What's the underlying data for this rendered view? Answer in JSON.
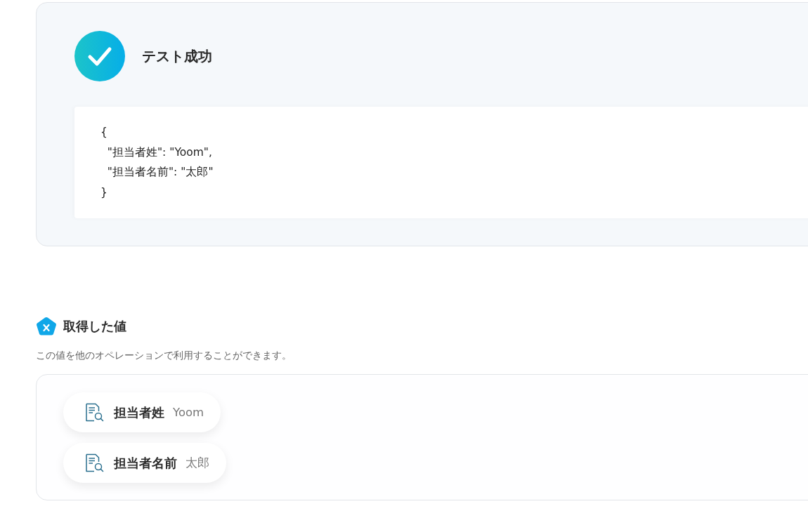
{
  "test_result": {
    "passed": true,
    "title": "テスト成功",
    "output": "{\n  \"担当者姓\": \"Yoom\",\n  \"担当者名前\": \"太郎\"\n}"
  },
  "retrieved_values": {
    "title": "取得した値",
    "description": "この値を他のオペレーションで利用することができます。",
    "items": [
      {
        "label": "担当者姓",
        "value": "Yoom"
      },
      {
        "label": "担当者名前",
        "value": "太郎"
      }
    ]
  }
}
